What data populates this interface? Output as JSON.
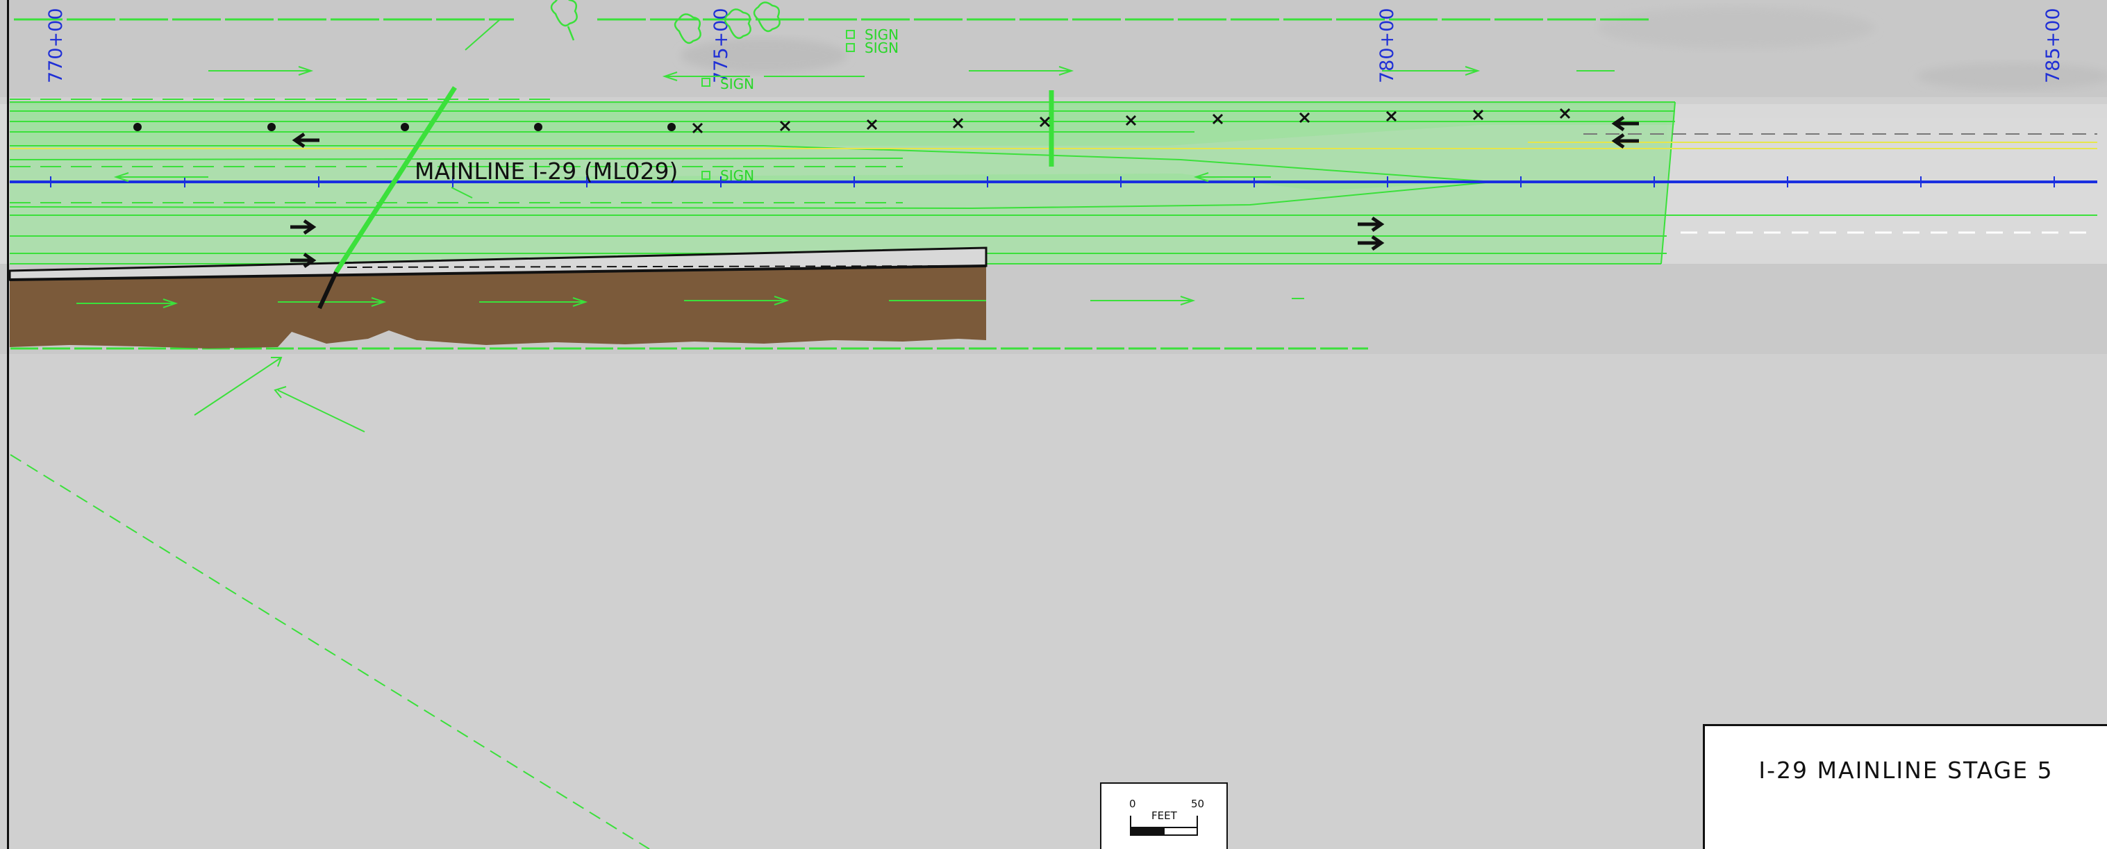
{
  "sheet": {
    "title": "I-29 MAINLINE STAGE 5",
    "alignment_label": "MAINLINE I-29 (ML029)"
  },
  "stations": [
    "770+00",
    "775+00",
    "780+00",
    "785+00"
  ],
  "signs": [
    "SIGN",
    "SIGN",
    "SIGN",
    "SIGN"
  ],
  "scale_bar": {
    "min": "0",
    "max": "50",
    "unit": "FEET"
  },
  "colors": {
    "alignment": "#1a2fe0",
    "proposed": "#3be03b",
    "pavement_removal": "#7b5a3a",
    "background": "#cfcfcf"
  },
  "symbols": [
    "tree-icon",
    "sign-icon",
    "traffic-arrow-icon",
    "barrier-x-icon",
    "post-dot-icon"
  ]
}
